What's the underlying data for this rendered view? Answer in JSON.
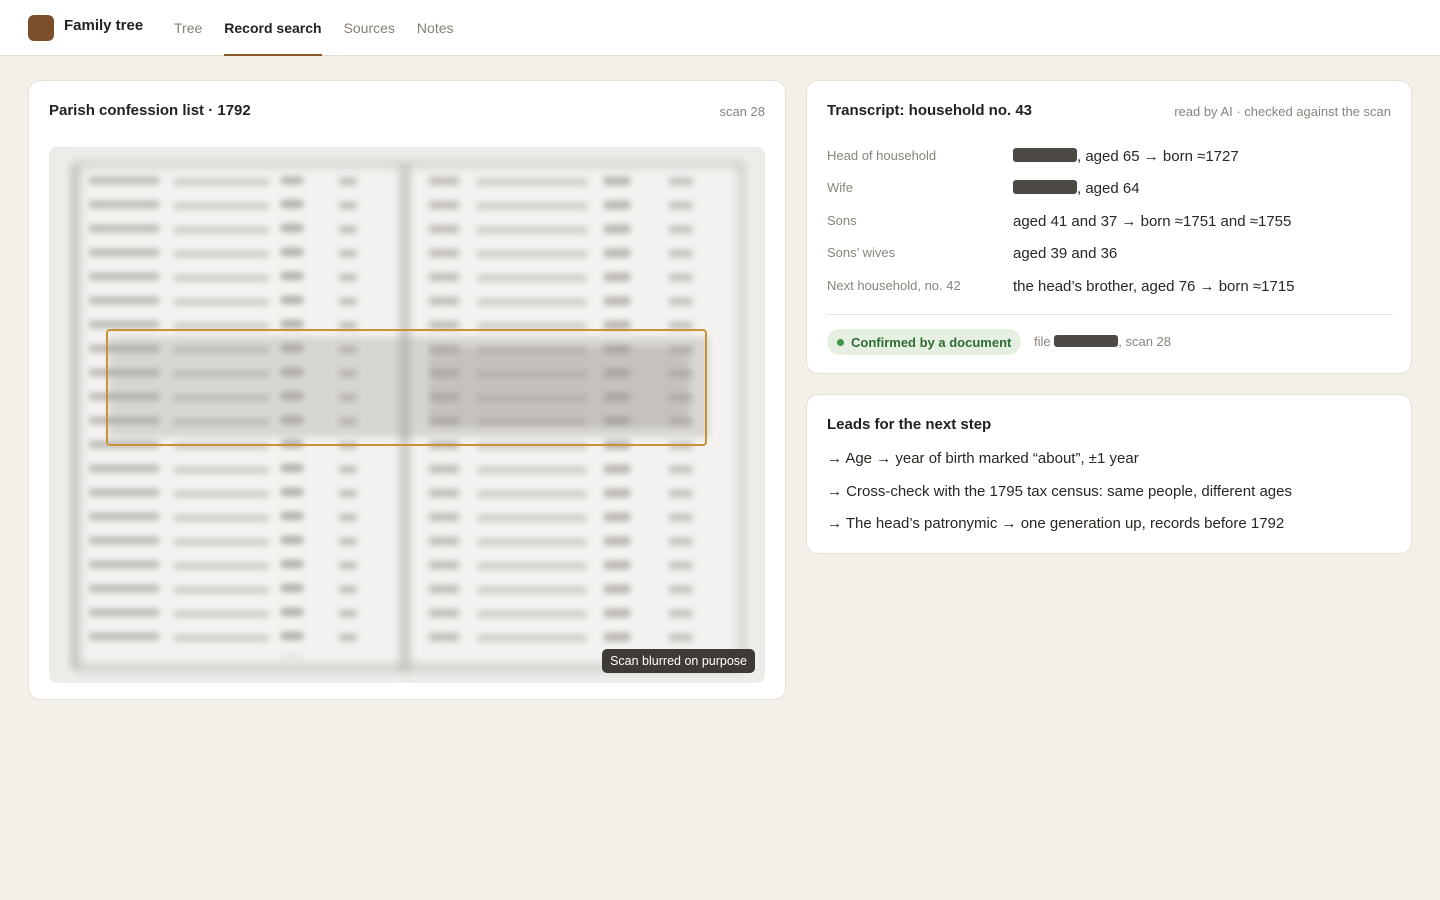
{
  "app": {
    "title": "Family tree"
  },
  "nav": {
    "tabs": [
      {
        "label": "Tree"
      },
      {
        "label": "Record search",
        "active": true
      },
      {
        "label": "Sources"
      },
      {
        "label": "Notes"
      }
    ]
  },
  "scan": {
    "title": "Parish confession list · 1792",
    "scan_label": "scan 28",
    "blur_note": "Scan blurred on purpose"
  },
  "transcript": {
    "title": "Transcript: household no. 43",
    "meta": "read by AI · checked against the scan",
    "rows": [
      {
        "label": "Head of household",
        "redacted": true,
        "value": ", aged 65 → born ≈1727"
      },
      {
        "label": "Wife",
        "redacted": true,
        "value": ", aged 64"
      },
      {
        "label": "Sons",
        "redacted": false,
        "value": "aged 41 and 37 → born ≈1751 and ≈1755"
      },
      {
        "label": "Sons’ wives",
        "redacted": false,
        "value": "aged 39 and 36"
      },
      {
        "label": "Next household, no. 42",
        "redacted": false,
        "value": "the head’s brother, aged 76 → born ≈1715"
      }
    ],
    "confirmed_label": "Confirmed by a document",
    "file_prefix": "file",
    "file_suffix": ", scan 28"
  },
  "leads": {
    "title": "Leads for the next step",
    "items": [
      "→ Age → year of birth marked “about”, ±1 year",
      "→ Cross-check with the 1795 tax census: same people, different ages",
      "→ The head’s patronymic → one generation up, records before 1792"
    ]
  },
  "colors": {
    "accent": "#8a5a2c",
    "highlight": "#c8923a",
    "confirmed": "#2f6b35"
  }
}
